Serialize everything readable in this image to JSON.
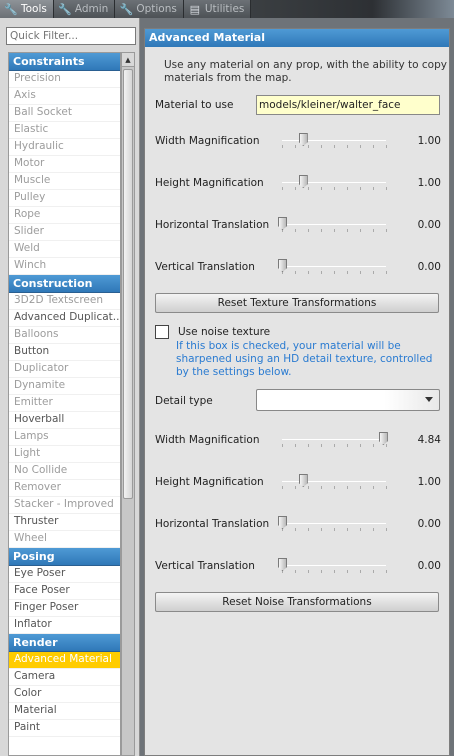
{
  "tabs": [
    {
      "label": "Tools",
      "icon": "wrench-icon",
      "active": true
    },
    {
      "label": "Admin",
      "icon": "wrench-icon",
      "active": false
    },
    {
      "label": "Options",
      "icon": "wrench-icon",
      "active": false
    },
    {
      "label": "Utilities",
      "icon": "document-icon",
      "active": false
    }
  ],
  "quick_filter": {
    "placeholder": "Quick Filter..."
  },
  "categories": [
    {
      "name": "Constraints",
      "items": [
        {
          "label": "Precision",
          "enabled": false
        },
        {
          "label": "Axis",
          "enabled": false
        },
        {
          "label": "Ball Socket",
          "enabled": false
        },
        {
          "label": "Elastic",
          "enabled": false
        },
        {
          "label": "Hydraulic",
          "enabled": false
        },
        {
          "label": "Motor",
          "enabled": false
        },
        {
          "label": "Muscle",
          "enabled": false
        },
        {
          "label": "Pulley",
          "enabled": false
        },
        {
          "label": "Rope",
          "enabled": false
        },
        {
          "label": "Slider",
          "enabled": false
        },
        {
          "label": "Weld",
          "enabled": false
        },
        {
          "label": "Winch",
          "enabled": false
        }
      ]
    },
    {
      "name": "Construction",
      "items": [
        {
          "label": "3D2D Textscreen",
          "enabled": false
        },
        {
          "label": "Advanced Duplicat...",
          "enabled": true
        },
        {
          "label": "Balloons",
          "enabled": false
        },
        {
          "label": "Button",
          "enabled": true
        },
        {
          "label": "Duplicator",
          "enabled": false
        },
        {
          "label": "Dynamite",
          "enabled": false
        },
        {
          "label": "Emitter",
          "enabled": false
        },
        {
          "label": "Hoverball",
          "enabled": true
        },
        {
          "label": "Lamps",
          "enabled": false
        },
        {
          "label": "Light",
          "enabled": false
        },
        {
          "label": "No Collide",
          "enabled": false
        },
        {
          "label": "Remover",
          "enabled": false
        },
        {
          "label": "Stacker - Improved",
          "enabled": false
        },
        {
          "label": "Thruster",
          "enabled": true
        },
        {
          "label": "Wheel",
          "enabled": false
        }
      ]
    },
    {
      "name": "Posing",
      "items": [
        {
          "label": "Eye Poser",
          "enabled": true
        },
        {
          "label": "Face Poser",
          "enabled": true
        },
        {
          "label": "Finger Poser",
          "enabled": true
        },
        {
          "label": "Inflator",
          "enabled": true
        }
      ]
    },
    {
      "name": "Render",
      "items": [
        {
          "label": "Advanced Material",
          "enabled": true,
          "selected": true
        },
        {
          "label": "Camera",
          "enabled": true
        },
        {
          "label": "Color",
          "enabled": true
        },
        {
          "label": "Material",
          "enabled": true
        },
        {
          "label": "Paint",
          "enabled": true
        }
      ]
    }
  ],
  "panel": {
    "title": "Advanced Material",
    "description": "Use any material on any prop, with the ability to copy materials from the map.",
    "material_label": "Material to use",
    "material_value": "models/kleiner/walter_face",
    "texture_sliders": [
      {
        "label": "Width Magnification",
        "value": "1.00",
        "fraction": 0.2
      },
      {
        "label": "Height Magnification",
        "value": "1.00",
        "fraction": 0.2
      },
      {
        "label": "Horizontal Translation",
        "value": "0.00",
        "fraction": 0.0
      },
      {
        "label": "Vertical Translation",
        "value": "0.00",
        "fraction": 0.0
      }
    ],
    "reset_texture_label": "Reset Texture Transformations",
    "noise_checkbox_label": "Use noise texture",
    "noise_checked": false,
    "noise_help": "If this box is checked, your material will be sharpened using an HD detail texture, controlled by the settings below.",
    "detail_type_label": "Detail type",
    "detail_type_value": "",
    "noise_sliders": [
      {
        "label": "Width Magnification",
        "value": "4.84",
        "fraction": 0.97
      },
      {
        "label": "Height Magnification",
        "value": "1.00",
        "fraction": 0.2
      },
      {
        "label": "Horizontal Translation",
        "value": "0.00",
        "fraction": 0.0
      },
      {
        "label": "Vertical Translation",
        "value": "0.00",
        "fraction": 0.0
      }
    ],
    "reset_noise_label": "Reset Noise Transformations"
  },
  "colors": {
    "category_header": "#3a87c8",
    "selected_item": "#ffcc00",
    "help_text": "#2a7bd1",
    "text_field_bg": "#ffffcc"
  }
}
